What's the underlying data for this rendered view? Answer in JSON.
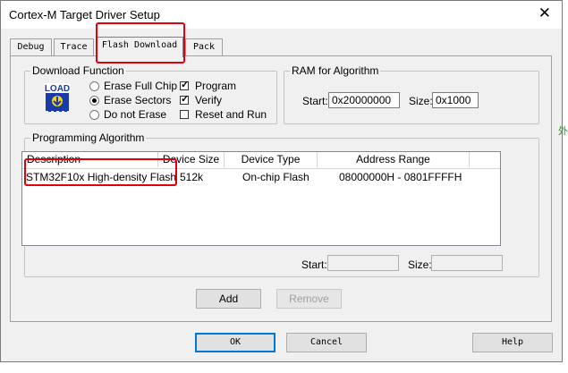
{
  "window": {
    "title": "Cortex-M Target Driver Setup",
    "close_glyph": "✕"
  },
  "tabs": [
    {
      "label": "Debug",
      "active": false
    },
    {
      "label": "Trace",
      "active": false
    },
    {
      "label": "Flash Download",
      "active": true
    },
    {
      "label": "Pack",
      "active": false
    }
  ],
  "download_function": {
    "title": "Download Function",
    "icon_text": "LOAD",
    "erase_options": [
      {
        "label": "Erase Full Chip",
        "selected": false
      },
      {
        "label": "Erase Sectors",
        "selected": true
      },
      {
        "label": "Do not Erase",
        "selected": false
      }
    ],
    "checks": [
      {
        "label": "Program",
        "checked": true
      },
      {
        "label": "Verify",
        "checked": true
      },
      {
        "label": "Reset and Run",
        "checked": false
      }
    ]
  },
  "ram": {
    "title": "RAM for Algorithm",
    "start_label": "Start:",
    "start_value": "0x20000000",
    "size_label": "Size:",
    "size_value": "0x1000"
  },
  "programming": {
    "title": "Programming Algorithm",
    "columns": [
      "Description",
      "Device Size",
      "Device Type",
      "Address Range"
    ],
    "rows": [
      {
        "description": "STM32F10x High-density Flash",
        "size": "512k",
        "type": "On-chip Flash",
        "range": "08000000H - 0801FFFFH"
      }
    ],
    "start_label": "Start:",
    "start_value": "",
    "size_label": "Size:",
    "size_value": "",
    "add_label": "Add",
    "remove_label": "Remove"
  },
  "footer": {
    "ok_label": "OK",
    "cancel_label": "Cancel",
    "help_label": "Help"
  },
  "background": {
    "side_glyph": "外"
  },
  "colors": {
    "highlight": "#e0000f",
    "icon_blue": "#1a3aa8",
    "icon_yellow": "#f2d21b"
  }
}
